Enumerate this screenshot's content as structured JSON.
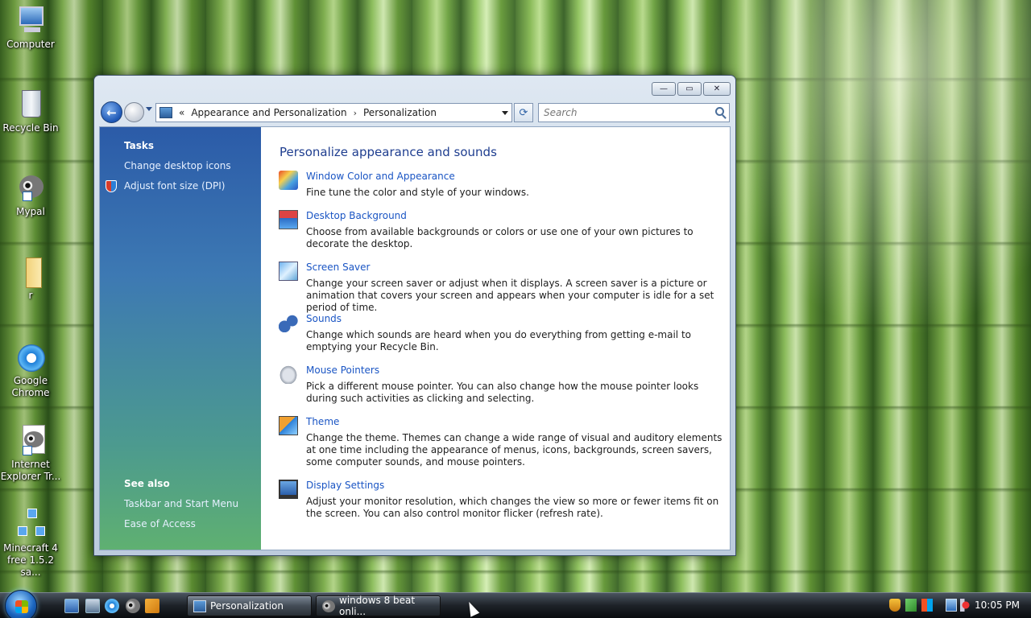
{
  "desktop": {
    "icons": [
      {
        "label": "Computer"
      },
      {
        "label": "Recycle Bin"
      },
      {
        "label": "Mypal"
      },
      {
        "label": "r"
      },
      {
        "label": "Google Chrome"
      },
      {
        "label": "Internet Explorer Tr..."
      },
      {
        "label": "Minecraft 4 free 1.5.2 sa..."
      }
    ]
  },
  "window": {
    "controls": {
      "minimize": "—",
      "maximize": "▭",
      "close": "✕"
    },
    "address": {
      "prefix": "«",
      "crumbs": [
        "Appearance and Personalization",
        "Personalization"
      ],
      "separator": "›"
    },
    "refresh_label": "⟳",
    "search": {
      "placeholder": "Search"
    },
    "sidebar": {
      "tasks_heading": "Tasks",
      "tasks": [
        {
          "label": "Change desktop icons"
        },
        {
          "label": "Adjust font size (DPI)"
        }
      ],
      "see_also_heading": "See also",
      "see_also": [
        {
          "label": "Taskbar and Start Menu"
        },
        {
          "label": "Ease of Access"
        }
      ]
    },
    "main": {
      "title": "Personalize appearance and sounds",
      "items": [
        {
          "icon": "color-scheme-icon",
          "title": "Window Color and Appearance",
          "description": "Fine tune the color and style of your windows."
        },
        {
          "icon": "desktop-background-icon",
          "title": "Desktop Background",
          "description": "Choose from available backgrounds or colors or use one of your own pictures to decorate the desktop."
        },
        {
          "icon": "screen-saver-icon",
          "title": "Screen Saver",
          "description": "Change your screen saver or adjust when it displays. A screen saver is a picture or animation that covers your screen and appears when your computer is idle for a set period of time."
        },
        {
          "icon": "sounds-icon",
          "title": "Sounds",
          "description": "Change which sounds are heard when you do everything from getting e-mail to emptying your Recycle Bin."
        },
        {
          "icon": "mouse-pointer-icon",
          "title": "Mouse Pointers",
          "description": "Pick a different mouse pointer. You can also change how the mouse pointer looks during such activities as clicking and selecting."
        },
        {
          "icon": "theme-icon",
          "title": "Theme",
          "description": "Change the theme. Themes can change a wide range of visual and auditory elements at one time including the appearance of menus, icons, backgrounds, screen savers, some computer sounds, and mouse pointers."
        },
        {
          "icon": "display-settings-icon",
          "title": "Display Settings",
          "description": "Adjust your monitor resolution, which changes the view so more or fewer items fit on the screen. You can also control monitor flicker (refresh rate)."
        }
      ]
    }
  },
  "taskbar": {
    "buttons": [
      {
        "label": "Personalization",
        "active": true
      },
      {
        "label": "windows 8 beat onli...",
        "active": false
      }
    ],
    "clock": "10:05 PM"
  },
  "colors": {
    "link": "#1a55c4",
    "title": "#1e3d8f",
    "sidebar_top": "#2b5ba8",
    "sidebar_bottom": "#5fb071"
  }
}
